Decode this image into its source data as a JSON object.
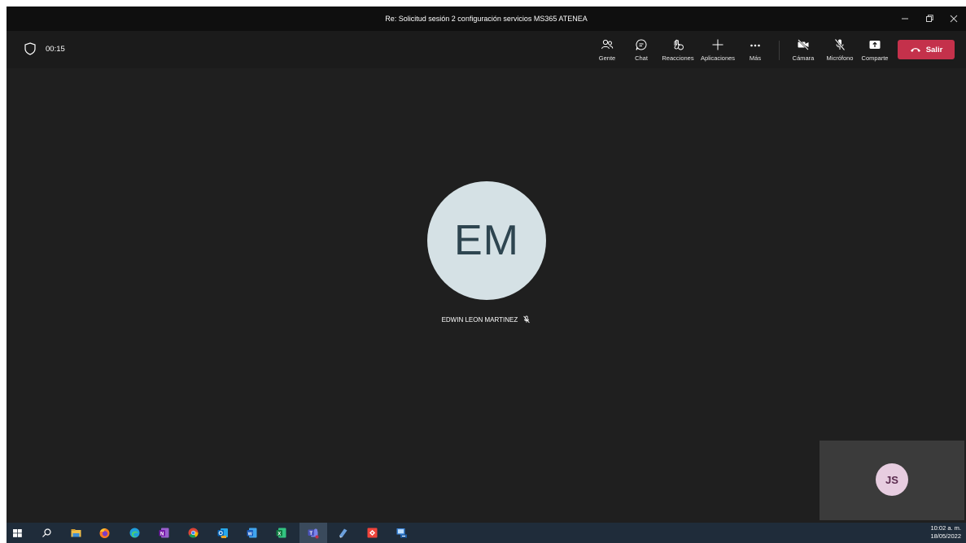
{
  "window": {
    "title": "Re: Solicitud sesión 2 configuración servicios MS365 ATENEA",
    "controls": [
      "minimize-icon",
      "restore-icon",
      "close-icon"
    ]
  },
  "meeting": {
    "duration": "00:15",
    "toolbar": {
      "people": "Gente",
      "chat": "Chat",
      "reactions": "Reacciones",
      "apps": "Aplicaciones",
      "more": "Más",
      "camera": "Cámara",
      "microphone": "Micrófono",
      "share": "Comparte",
      "leave": "Salir"
    },
    "main_participant": {
      "initials": "EM",
      "name": "EDWIN LEON MARTINEZ",
      "muted": true
    },
    "self_view": {
      "initials": "JS"
    }
  },
  "taskbar": {
    "apps": [
      "windows-start-icon",
      "search-icon",
      "file-explorer-icon",
      "firefox-icon",
      "edge-icon",
      "onenote-icon",
      "chrome-icon",
      "outlook-icon",
      "word-icon",
      "excel-icon",
      "teams-icon",
      "app-icon",
      "anydesk-icon",
      "remote-desktop-icon"
    ],
    "time": "10:02 a. m.",
    "date": "18/05/2022"
  },
  "colors": {
    "leave_button": "#c4314b",
    "stage_background": "#1f1f1f",
    "main_avatar": "#d5e1e5",
    "self_avatar": "#e7cde0"
  }
}
